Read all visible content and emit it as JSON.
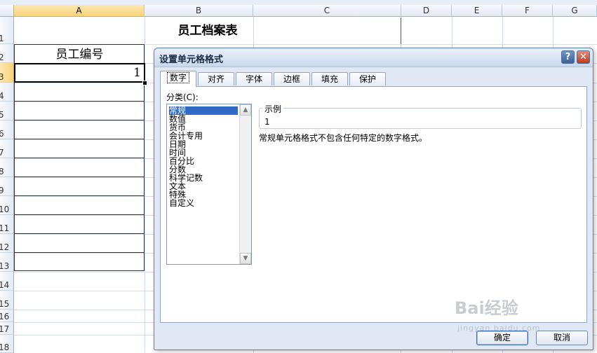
{
  "sheet": {
    "columns": [
      "A",
      "B",
      "C",
      "D",
      "E",
      "F",
      "G"
    ],
    "rows": [
      "1",
      "2",
      "3",
      "4",
      "5",
      "6",
      "7",
      "8",
      "9",
      "10",
      "11",
      "12",
      "13",
      "14",
      "15",
      "16",
      "17",
      "18"
    ],
    "title": "员工档案表",
    "header_a2": "员工编号",
    "active_cell_value": "1"
  },
  "dialog": {
    "title": "设置单元格格式",
    "help_glyph": "?",
    "close_glyph": "✕",
    "tabs": [
      "数字",
      "对齐",
      "字体",
      "边框",
      "填充",
      "保护"
    ],
    "active_tab": "数字",
    "category_label": "分类(C):",
    "categories": [
      "常规",
      "数值",
      "货币",
      "会计专用",
      "日期",
      "时间",
      "百分比",
      "分数",
      "科学记数",
      "文本",
      "特殊",
      "自定义"
    ],
    "selected_category": "常规",
    "sample_label": "示例",
    "sample_value": "1",
    "description": "常规单元格格式不包含任何特定的数字格式。",
    "ok_label": "确定",
    "cancel_label": "取消"
  },
  "watermark": {
    "brand": "Bai经验",
    "url": "jingyan.baidu.com"
  },
  "colors": {
    "selection_blue": "#3169c6",
    "header_highlight": "#f8d27a",
    "dialog_bg": "#dfe8f4"
  }
}
